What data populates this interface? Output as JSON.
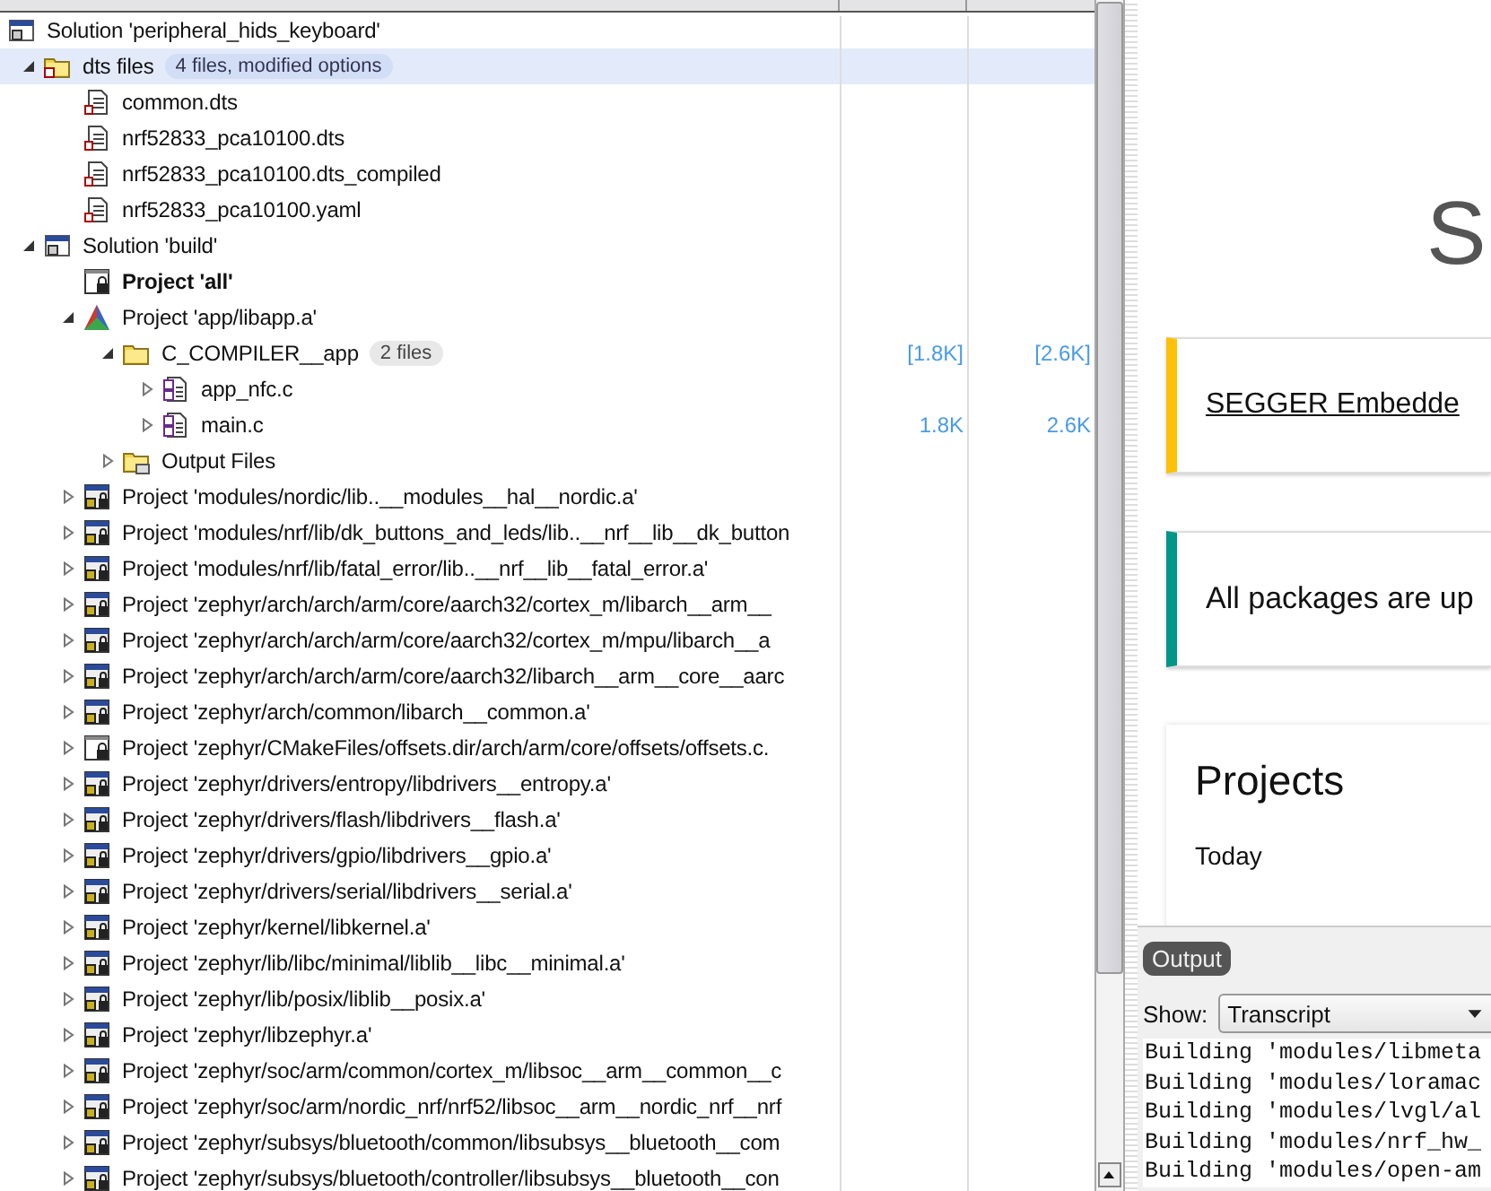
{
  "tree": [
    {
      "kind": "solution",
      "label": "Solution 'peripheral_hids_keyboard'",
      "selected": false,
      "children": [
        {
          "kind": "dts-folder",
          "label": "dts files",
          "badge": "4 files, modified options",
          "selected": true,
          "expanded": true,
          "children": [
            {
              "kind": "dts-file",
              "label": "common.dts",
              "selected": false
            },
            {
              "kind": "dts-file",
              "label": "nrf52833_pca10100.dts",
              "selected": false
            },
            {
              "kind": "dts-file",
              "label": "nrf52833_pca10100.dts_compiled",
              "selected": false
            },
            {
              "kind": "dts-file",
              "label": "nrf52833_pca10100.yaml",
              "selected": false
            }
          ]
        },
        {
          "kind": "solution",
          "label": "Solution 'build'",
          "selected": false,
          "expanded": true,
          "children": [
            {
              "kind": "object-project",
              "label": "Project 'all'",
              "active": true,
              "selected": false
            },
            {
              "kind": "app-project",
              "label": "Project 'app/libapp.a'",
              "selected": false,
              "expanded": true,
              "children": [
                {
                  "kind": "folder",
                  "label": "C_COMPILER__app",
                  "badge": "2 files",
                  "code": "[1.8K]",
                  "data": "[2.6K]",
                  "selected": false,
                  "expanded": true,
                  "children": [
                    {
                      "kind": "c-file",
                      "label": "app_nfc.c",
                      "selected": false,
                      "expanded": false
                    },
                    {
                      "kind": "c-file",
                      "label": "main.c",
                      "code": "1.8K",
                      "data": "2.6K",
                      "selected": false,
                      "expanded": false
                    }
                  ]
                },
                {
                  "kind": "output-folder",
                  "label": "Output Files",
                  "selected": false,
                  "expanded": false
                }
              ]
            },
            {
              "kind": "lib-project",
              "label": "Project 'modules/nordic/lib..__modules__hal__nordic.a'",
              "selected": false,
              "expanded": false
            },
            {
              "kind": "lib-project",
              "label": "Project 'modules/nrf/lib/dk_buttons_and_leds/lib..__nrf__lib__dk_button",
              "selected": false,
              "expanded": false
            },
            {
              "kind": "lib-project",
              "label": "Project 'modules/nrf/lib/fatal_error/lib..__nrf__lib__fatal_error.a'",
              "selected": false,
              "expanded": false
            },
            {
              "kind": "lib-project",
              "label": "Project 'zephyr/arch/arch/arm/core/aarch32/cortex_m/libarch__arm__",
              "selected": false,
              "expanded": false
            },
            {
              "kind": "lib-project",
              "label": "Project 'zephyr/arch/arch/arm/core/aarch32/cortex_m/mpu/libarch__a",
              "selected": false,
              "expanded": false
            },
            {
              "kind": "lib-project",
              "label": "Project 'zephyr/arch/arch/arm/core/aarch32/libarch__arm__core__aarc",
              "selected": false,
              "expanded": false
            },
            {
              "kind": "lib-project",
              "label": "Project 'zephyr/arch/common/libarch__common.a'",
              "selected": false,
              "expanded": false
            },
            {
              "kind": "object-project",
              "label": "Project 'zephyr/CMakeFiles/offsets.dir/arch/arm/core/offsets/offsets.c.",
              "selected": false,
              "expanded": false
            },
            {
              "kind": "lib-project",
              "label": "Project 'zephyr/drivers/entropy/libdrivers__entropy.a'",
              "selected": false,
              "expanded": false
            },
            {
              "kind": "lib-project",
              "label": "Project 'zephyr/drivers/flash/libdrivers__flash.a'",
              "selected": false,
              "expanded": false
            },
            {
              "kind": "lib-project",
              "label": "Project 'zephyr/drivers/gpio/libdrivers__gpio.a'",
              "selected": false,
              "expanded": false
            },
            {
              "kind": "lib-project",
              "label": "Project 'zephyr/drivers/serial/libdrivers__serial.a'",
              "selected": false,
              "expanded": false
            },
            {
              "kind": "lib-project",
              "label": "Project 'zephyr/kernel/libkernel.a'",
              "selected": false,
              "expanded": false
            },
            {
              "kind": "lib-project",
              "label": "Project 'zephyr/lib/libc/minimal/liblib__libc__minimal.a'",
              "selected": false,
              "expanded": false
            },
            {
              "kind": "lib-project",
              "label": "Project 'zephyr/lib/posix/liblib__posix.a'",
              "selected": false,
              "expanded": false
            },
            {
              "kind": "lib-project",
              "label": "Project 'zephyr/libzephyr.a'",
              "selected": false,
              "expanded": false
            },
            {
              "kind": "lib-project",
              "label": "Project 'zephyr/soc/arm/common/cortex_m/libsoc__arm__common__c",
              "selected": false,
              "expanded": false
            },
            {
              "kind": "lib-project",
              "label": "Project 'zephyr/soc/arm/nordic_nrf/nrf52/libsoc__arm__nordic_nrf__nrf",
              "selected": false,
              "expanded": false
            },
            {
              "kind": "lib-project",
              "label": "Project 'zephyr/subsys/bluetooth/common/libsubsys__bluetooth__com",
              "selected": false,
              "expanded": false
            },
            {
              "kind": "lib-project",
              "label": "Project 'zephyr/subsys/bluetooth/controller/libsubsys__bluetooth__con",
              "selected": false,
              "expanded": false
            }
          ]
        }
      ]
    }
  ],
  "welcome": {
    "title": "S",
    "notices": [
      {
        "kind": "link",
        "text": "SEGGER Embedde",
        "color": "#ffc107"
      },
      {
        "kind": "text",
        "text": "All packages are up",
        "color": "#009688"
      }
    ],
    "projects_title": "Projects",
    "projects_group": "Today"
  },
  "output": {
    "tab": "Output",
    "show_label": "Show:",
    "show_value": "Transcript",
    "lines": [
      "Building 'modules/libmeta",
      "Building 'modules/loramac",
      "Building 'modules/lvgl/al",
      "Building 'modules/nrf_hw_",
      "Building 'modules/open-am"
    ]
  }
}
